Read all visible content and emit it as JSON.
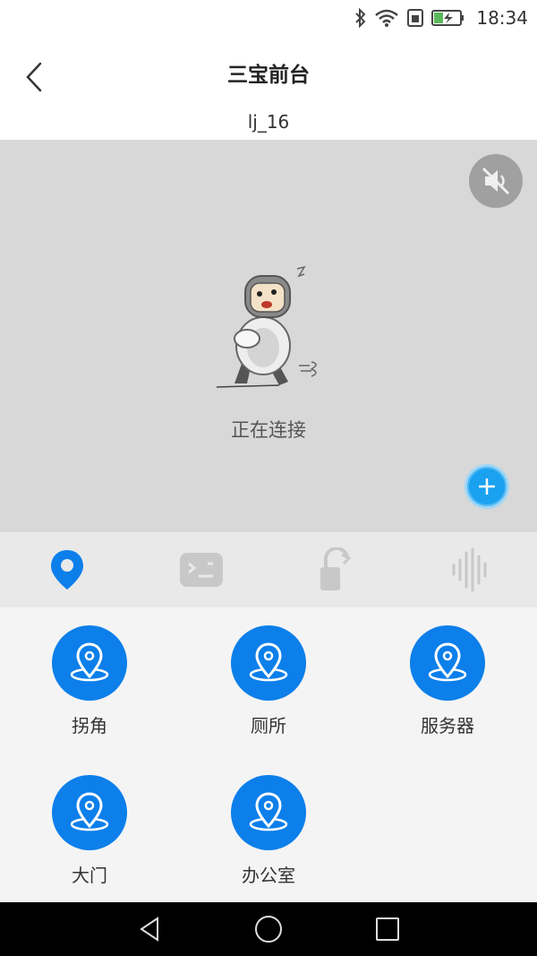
{
  "status_bar": {
    "time": "18:34",
    "icons": [
      "bluetooth-icon",
      "wifi-icon",
      "sim-icon",
      "battery-charging-icon"
    ]
  },
  "header": {
    "title": "三宝前台",
    "subtitle": "lj_16"
  },
  "video": {
    "status_text": "正在连接",
    "mute_icon": "speaker-muted-icon",
    "add_icon": "plus-icon"
  },
  "tabs": [
    {
      "name": "location",
      "icon": "location-pin-icon",
      "active": true
    },
    {
      "name": "terminal",
      "icon": "robot-face-icon",
      "active": false
    },
    {
      "name": "unlock",
      "icon": "unlock-icon",
      "active": false
    },
    {
      "name": "voice",
      "icon": "sound-wave-icon",
      "active": false
    }
  ],
  "locations": [
    {
      "label": "拐角"
    },
    {
      "label": "厕所"
    },
    {
      "label": "服务器"
    },
    {
      "label": "大门"
    },
    {
      "label": "办公室"
    }
  ],
  "colors": {
    "accent": "#0c7fea",
    "fab": "#1aa1f0",
    "video_bg": "#d8d8d8",
    "tab_bg": "#e9e9e9",
    "grid_bg": "#f4f4f4"
  }
}
